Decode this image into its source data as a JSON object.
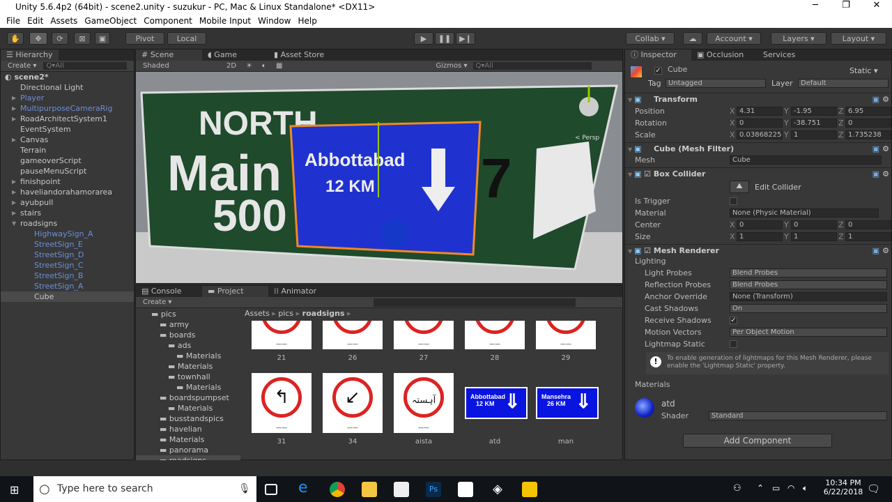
{
  "window": {
    "title": "Unity 5.6.4p2 (64bit) - scene2.unity - suzukur - PC, Mac & Linux Standalone* <DX11>",
    "minimize": "─",
    "maximize": "❐",
    "close": "✕"
  },
  "menu": [
    "File",
    "Edit",
    "Assets",
    "GameObject",
    "Component",
    "Mobile Input",
    "Window",
    "Help"
  ],
  "toolbar": {
    "pivot": "Pivot",
    "local": "Local",
    "collab": "Collab ▾",
    "account": "Account ▾",
    "layers": "Layers ▾",
    "layout": "Layout ▾"
  },
  "hierarchy": {
    "tab": "Hierarchy",
    "create": "Create ▾",
    "search": "Q▾All",
    "scene": "scene2*",
    "items": [
      {
        "label": "Directional Light",
        "indent": 1,
        "arrow": false,
        "prefab": false
      },
      {
        "label": "Player",
        "indent": 1,
        "arrow": true,
        "prefab": true
      },
      {
        "label": "MultipurposeCameraRig",
        "indent": 1,
        "arrow": true,
        "prefab": true
      },
      {
        "label": "RoadArchitectSystem1",
        "indent": 1,
        "arrow": true,
        "prefab": false
      },
      {
        "label": "EventSystem",
        "indent": 1,
        "arrow": false,
        "prefab": false
      },
      {
        "label": "Canvas",
        "indent": 1,
        "arrow": true,
        "prefab": false
      },
      {
        "label": "Terrain",
        "indent": 1,
        "arrow": false,
        "prefab": false
      },
      {
        "label": "gameoverScript",
        "indent": 1,
        "arrow": false,
        "prefab": false
      },
      {
        "label": "pauseMenuScript",
        "indent": 1,
        "arrow": false,
        "prefab": false
      },
      {
        "label": "finishpoint",
        "indent": 1,
        "arrow": true,
        "prefab": false
      },
      {
        "label": "haveliandorahamorarea",
        "indent": 1,
        "arrow": true,
        "prefab": false
      },
      {
        "label": "ayubpull",
        "indent": 1,
        "arrow": true,
        "prefab": false
      },
      {
        "label": "stairs",
        "indent": 1,
        "arrow": true,
        "prefab": false
      },
      {
        "label": "roadsigns",
        "indent": 1,
        "arrow": true,
        "prefab": false,
        "open": true
      },
      {
        "label": "HighwaySign_A",
        "indent": 2,
        "arrow": false,
        "prefab": true
      },
      {
        "label": "StreetSign_E",
        "indent": 2,
        "arrow": false,
        "prefab": true
      },
      {
        "label": "StreetSign_D",
        "indent": 2,
        "arrow": false,
        "prefab": true
      },
      {
        "label": "StreetSign_C",
        "indent": 2,
        "arrow": false,
        "prefab": true
      },
      {
        "label": "StreetSign_B",
        "indent": 2,
        "arrow": false,
        "prefab": true
      },
      {
        "label": "StreetSign_A",
        "indent": 2,
        "arrow": false,
        "prefab": true
      },
      {
        "label": "Cube",
        "indent": 2,
        "arrow": false,
        "prefab": false,
        "selected": true
      }
    ]
  },
  "scene": {
    "tabs": [
      "Scene",
      "Game",
      "Asset Store"
    ],
    "shaded": "Shaded",
    "mode2d": "2D",
    "gizmos": "Gizmos ▾",
    "search": "Q▾All",
    "persp": "< Persp",
    "sign_back": {
      "line1": "NORTH",
      "line2": "Main",
      "line3": "500",
      "num": "7"
    },
    "sign_front": {
      "line1": "Abbottabad",
      "line2": "12 KM"
    }
  },
  "project": {
    "tabs": [
      "Console",
      "Project",
      "Animator"
    ],
    "create": "Create ▾",
    "breadcrumb": [
      "Assets",
      "pics",
      "roadsigns"
    ],
    "tree": [
      {
        "label": "pics",
        "indent": 1
      },
      {
        "label": "army",
        "indent": 2
      },
      {
        "label": "boards",
        "indent": 2
      },
      {
        "label": "ads",
        "indent": 3
      },
      {
        "label": "Materials",
        "indent": 4
      },
      {
        "label": "Materials",
        "indent": 3
      },
      {
        "label": "townhall",
        "indent": 3
      },
      {
        "label": "Materials",
        "indent": 4
      },
      {
        "label": "boardspumpset",
        "indent": 2
      },
      {
        "label": "Materials",
        "indent": 3
      },
      {
        "label": "busstandspics",
        "indent": 2
      },
      {
        "label": "havelian",
        "indent": 2
      },
      {
        "label": "Materials",
        "indent": 2
      },
      {
        "label": "panorama",
        "indent": 2
      },
      {
        "label": "roadsigns",
        "indent": 2,
        "selected": true
      }
    ],
    "assets": [
      {
        "name": "21",
        "kind": "circle"
      },
      {
        "name": "26",
        "kind": "circle"
      },
      {
        "name": "27",
        "kind": "circle"
      },
      {
        "name": "28",
        "kind": "circle"
      },
      {
        "name": "29",
        "kind": "circle"
      },
      {
        "name": "31",
        "kind": "circle",
        "glyph": "↰"
      },
      {
        "name": "34",
        "kind": "circle",
        "glyph": "↙"
      },
      {
        "name": "aista",
        "kind": "circle",
        "glyph": "آہستہ"
      },
      {
        "name": "atd",
        "kind": "blue",
        "line1": "Abbottabad",
        "line2": "12 KM"
      },
      {
        "name": "man",
        "kind": "blue",
        "line1": "Mansehra",
        "line2": "26 KM"
      }
    ]
  },
  "inspector": {
    "tabs": [
      "Inspector",
      "Occlusion",
      "Services"
    ],
    "name": "Cube",
    "static": "Static",
    "tag_label": "Tag",
    "tag": "Untagged",
    "layer_label": "Layer",
    "layer": "Default",
    "transform": {
      "title": "Transform",
      "position": {
        "label": "Position",
        "x": "4.31",
        "y": "-1.95",
        "z": "6.95"
      },
      "rotation": {
        "label": "Rotation",
        "x": "0",
        "y": "-38.751",
        "z": "0"
      },
      "scale": {
        "label": "Scale",
        "x": "0.03868225",
        "y": "1",
        "z": "1.735238"
      }
    },
    "mesh_filter": {
      "title": "Cube (Mesh Filter)",
      "mesh_label": "Mesh",
      "mesh": "Cube"
    },
    "box_collider": {
      "title": "Box Collider",
      "edit": "Edit Collider",
      "is_trigger": "Is Trigger",
      "material_label": "Material",
      "material": "None (Physic Material)",
      "center": {
        "label": "Center",
        "x": "0",
        "y": "0",
        "z": "0"
      },
      "size": {
        "label": "Size",
        "x": "1",
        "y": "1",
        "z": "1"
      }
    },
    "mesh_renderer": {
      "title": "Mesh Renderer",
      "lighting": "Lighting",
      "light_probes_label": "Light Probes",
      "light_probes": "Blend Probes",
      "reflection_label": "Reflection Probes",
      "reflection": "Blend Probes",
      "anchor_label": "Anchor Override",
      "anchor": "None (Transform)",
      "cast_label": "Cast Shadows",
      "cast": "On",
      "receive_label": "Receive Shadows",
      "receive": true,
      "motion_label": "Motion Vectors",
      "motion": "Per Object Motion",
      "lightmap_label": "Lightmap Static",
      "lightmap": false,
      "info": "To enable generation of lightmaps for this Mesh Renderer, please enable the 'Lightmap Static' property.",
      "materials": "Materials"
    },
    "material": {
      "name": "atd",
      "shader_label": "Shader",
      "shader": "Standard"
    },
    "add_component": "Add Component"
  },
  "taskbar": {
    "search": "Type here to search",
    "time": "10:34 PM",
    "date": "6/22/2018"
  }
}
